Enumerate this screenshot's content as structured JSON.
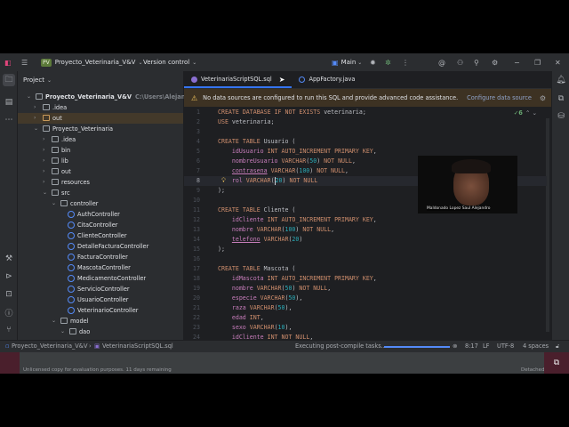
{
  "titlebar": {
    "project_badge": "PV",
    "project_name": "Proyecto_Veterinaria_V&V",
    "vcs": "Version control",
    "run_config": "Main",
    "icons": [
      "intellij-logo",
      "hamburger-menu-icon",
      "build-icon",
      "debug-icon",
      "more-icon",
      "ai-assistant-icon",
      "add-user-icon",
      "search-icon",
      "settings-icon",
      "minimize-icon",
      "restore-icon",
      "close-icon"
    ]
  },
  "project_panel": {
    "title": "Project",
    "tree": [
      {
        "label": "Proyecto_Veterinaria_V&V",
        "path": "C:\\Users\\Alejandro\\De",
        "level": 0,
        "type": "module",
        "expanded": true
      },
      {
        "label": ".idea",
        "level": 1,
        "type": "folder",
        "expanded": false
      },
      {
        "label": "out",
        "level": 1,
        "type": "folder",
        "expanded": false,
        "selected": true
      },
      {
        "label": "Proyecto_Veterinaria",
        "level": 1,
        "type": "folder",
        "expanded": true
      },
      {
        "label": ".idea",
        "level": 2,
        "type": "folder",
        "expanded": false
      },
      {
        "label": "bin",
        "level": 2,
        "type": "folder",
        "expanded": false
      },
      {
        "label": "lib",
        "level": 2,
        "type": "folder",
        "expanded": false
      },
      {
        "label": "out",
        "level": 2,
        "type": "folder",
        "expanded": false
      },
      {
        "label": "resources",
        "level": 2,
        "type": "folder",
        "expanded": false
      },
      {
        "label": "src",
        "level": 2,
        "type": "folder",
        "expanded": true
      },
      {
        "label": "controller",
        "level": 3,
        "type": "package",
        "expanded": true
      },
      {
        "label": "AuthController",
        "level": 4,
        "type": "class"
      },
      {
        "label": "CitaController",
        "level": 4,
        "type": "class"
      },
      {
        "label": "ClienteController",
        "level": 4,
        "type": "class"
      },
      {
        "label": "DetalleFacturaController",
        "level": 4,
        "type": "class"
      },
      {
        "label": "FacturaController",
        "level": 4,
        "type": "class"
      },
      {
        "label": "MascotaController",
        "level": 4,
        "type": "class"
      },
      {
        "label": "MedicamentoController",
        "level": 4,
        "type": "class"
      },
      {
        "label": "ServicioController",
        "level": 4,
        "type": "class"
      },
      {
        "label": "UsuarioController",
        "level": 4,
        "type": "class"
      },
      {
        "label": "VeterinarioController",
        "level": 4,
        "type": "class"
      },
      {
        "label": "model",
        "level": 3,
        "type": "package",
        "expanded": true
      },
      {
        "label": "dao",
        "level": 4,
        "type": "package",
        "expanded": true
      }
    ]
  },
  "editor": {
    "tabs": [
      {
        "label": "VeterinariaScriptSQL.sql",
        "active": true,
        "color": "#8a6fd1"
      },
      {
        "label": "AppFactory.java",
        "active": false,
        "color": "#548af7"
      }
    ],
    "banner": {
      "message": "No data sources are configured to run this SQL and provide advanced code assistance.",
      "action": "Configure data source"
    },
    "inspection_count": "6",
    "current_line": 8,
    "lines": [
      "CREATE DATABASE IF NOT EXISTS veterinaria;",
      "USE veterinaria;",
      "",
      "CREATE TABLE Usuario (",
      "    idUsuario INT AUTO_INCREMENT PRIMARY KEY,",
      "    nombreUsuario VARCHAR(50) NOT NULL,",
      "    contrasena VARCHAR(100) NOT NULL,",
      "    rol VARCHAR(20) NOT NULL",
      ");",
      "",
      "CREATE TABLE Cliente (",
      "    idCliente INT AUTO_INCREMENT PRIMARY KEY,",
      "    nombre VARCHAR(100) NOT NULL,",
      "    telefono VARCHAR(20)",
      ");",
      "",
      "CREATE TABLE Mascota (",
      "    idMascota INT AUTO_INCREMENT PRIMARY KEY,",
      "    nombre VARCHAR(50) NOT NULL,",
      "    especie VARCHAR(50),",
      "    raza VARCHAR(50),",
      "    edad INT,",
      "    sexo VARCHAR(10),",
      "    idCliente INT NOT NULL,"
    ]
  },
  "webcam": {
    "name": "Maldonado Lopez Saul Alejandro"
  },
  "statusbar": {
    "breadcrumb_project": "Proyecto_Veterinaria_V&V",
    "breadcrumb_file": "VeterinariaScriptSQL.sql",
    "task": "Executing post-compile tasks...",
    "position": "8:17",
    "line_separator": "LF",
    "encoding": "UTF-8",
    "indent": "4 spaces"
  },
  "taskarea": {
    "license_notice": "Unlicensed copy for evaluation purposes. 11 days remaining",
    "detached": "Detached"
  }
}
